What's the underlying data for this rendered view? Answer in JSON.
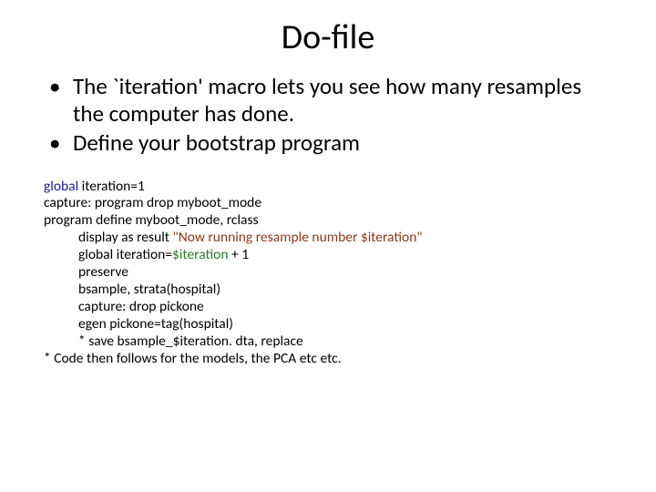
{
  "title": "Do-file",
  "bullets": [
    "The `iteration' macro lets you see how many resamples the computer has done.",
    "Define your bootstrap program"
  ],
  "code": {
    "l1a": "global",
    "l1b": " iteration=1",
    "l2a": "capture: program drop ",
    "l2b": "myboot_mode",
    "l3a": "program define ",
    "l3b": "myboot_mode, rclass",
    "l4a": "display as result ",
    "l4b": "\"Now running resample number $iteration\"",
    "l5a": "global iteration=",
    "l5b": "$iteration",
    "l5c": " + 1",
    "l6": "preserve",
    "l7": "bsample, strata(hospital)",
    "l8": "capture: drop pickone",
    "l9": "egen pickone=tag(hospital)",
    "l10": "* save bsample_$iteration. dta, replace",
    "l11": "* Code then follows for the models, the PCA etc etc."
  }
}
